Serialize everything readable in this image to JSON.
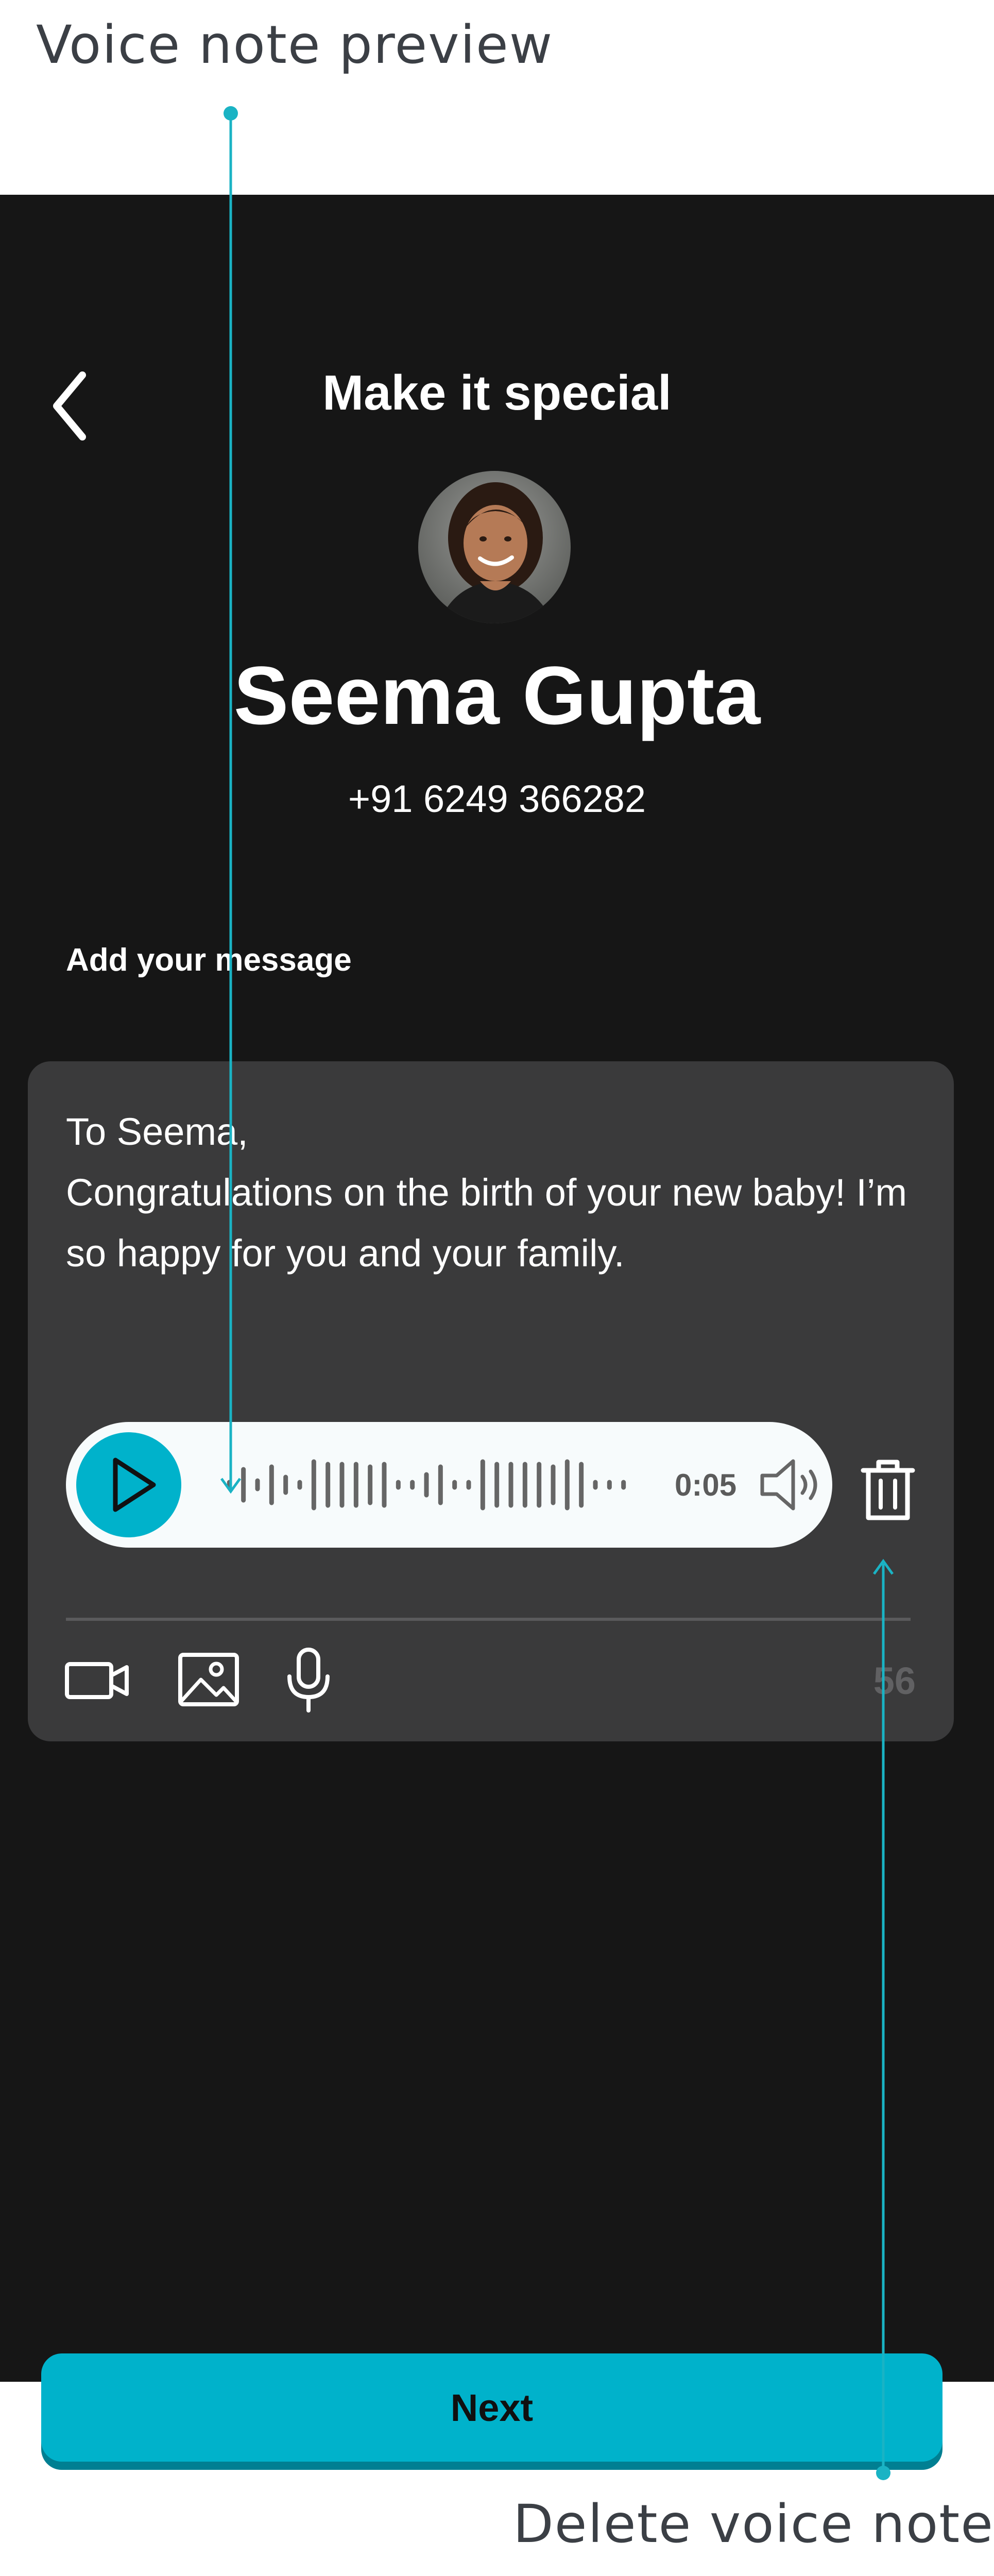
{
  "annotations": {
    "voice_note_preview": "Voice note preview",
    "delete_voice_note": "Delete voice note",
    "accent_color": "#1ab3c4"
  },
  "header": {
    "title": "Make it special",
    "back_icon": "chevron-left-icon"
  },
  "contact": {
    "name": "Seema Gupta",
    "phone": "+91 6249 366282"
  },
  "message": {
    "section_label": "Add your message",
    "text": "To Seema,\nCongratulations on the birth of your new baby! I’m so happy for you and your family.",
    "char_count": "56"
  },
  "voice_note": {
    "duration": "0:05",
    "play_icon": "play-icon",
    "volume_icon": "volume-icon",
    "delete_icon": "trash-icon"
  },
  "toolbar": {
    "icons": [
      "video-camera-icon",
      "image-icon",
      "microphone-icon"
    ]
  },
  "footer": {
    "next_label": "Next"
  },
  "colors": {
    "background": "#161616",
    "card": "#3a3a3b",
    "accent": "#00b2cb",
    "text": "#ffffff"
  }
}
